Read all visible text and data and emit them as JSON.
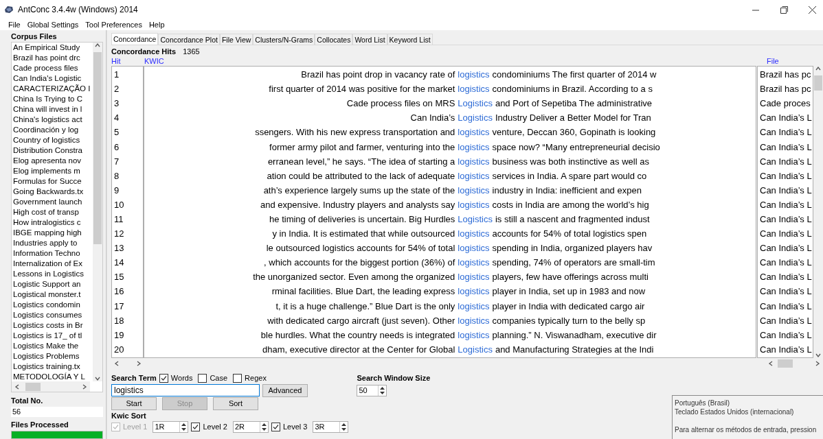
{
  "window": {
    "title": "AntConc 3.4.4w (Windows) 2014"
  },
  "menu": [
    "File",
    "Global Settings",
    "Tool Preferences",
    "Help"
  ],
  "corpus_files": {
    "label": "Corpus Files",
    "items": [
      "An Empirical Study",
      "Brazil has point drc",
      "Cade process files",
      "Can India's Logistic",
      "CARACTERIZAÇÃO I",
      "China Is Trying to C",
      "China will invest in l",
      "China's logistics act",
      "Coordinación y log",
      "Country of logistics",
      "Distribution Constra",
      "Elog apresenta nov",
      "Elog implements m",
      "Formulas for Succe",
      "Going Backwards.tx",
      "Government launch",
      "High cost of transp",
      "How intralogistics c",
      "IBGE mapping high",
      "Industries apply to",
      "Information Techno",
      "Internalization of Ex",
      "Lessons in Logistics",
      "Logistic Support an",
      "Logistical monster.t",
      "Logistics condomin",
      "Logistics consumes",
      "Logistics costs in Br",
      "Logistics is 17_ of tl",
      "Logistics Make the",
      "Logistics Problems",
      "Logistics training.tx",
      "METODOLOGÍA Y L"
    ]
  },
  "total": {
    "label": "Total No.",
    "value": "56"
  },
  "files_processed": {
    "label": "Files Processed",
    "level": 1
  },
  "tabs": [
    {
      "label": "Concordance",
      "selected": true
    },
    {
      "label": "Concordance Plot",
      "selected": false
    },
    {
      "label": "File View",
      "selected": false
    },
    {
      "label": "Clusters/N-Grams",
      "selected": false
    },
    {
      "label": "Collocates",
      "selected": false
    },
    {
      "label": "Word List",
      "selected": false
    },
    {
      "label": "Keyword List",
      "selected": false
    }
  ],
  "concordance": {
    "hits_label": "Concordance Hits",
    "hits": "1365",
    "columns": {
      "hit": "Hit",
      "kwic": "KWIC",
      "file": "File"
    },
    "rows": [
      {
        "hit": "1",
        "left": "Brazil has point drop in vacancy rate of",
        "keyword": "logistics",
        "right": "condominiums The first quarter of 2014 w",
        "file": "Brazil has pc"
      },
      {
        "hit": "2",
        "left": "first quarter of 2014 was positive for the market",
        "keyword": "logistics",
        "right": "condominiums in Brazil. According to a s",
        "file": "Brazil has pc"
      },
      {
        "hit": "3",
        "left": "Cade process files on MRS",
        "keyword": "Logistics",
        "right": "and Port of Sepetiba The administrative",
        "file": "Cade proces"
      },
      {
        "hit": "4",
        "left": "Can India’s",
        "keyword": "Logistics",
        "right": "Industry Deliver a Better Model for Tran",
        "file": "Can India’s L"
      },
      {
        "hit": "5",
        "left": "ssengers. With his new express transportation and",
        "keyword": "logistics",
        "right": "venture, Deccan 360, Gopinath is looking",
        "file": "Can India’s L"
      },
      {
        "hit": "6",
        "left": "former army pilot and farmer, venturing into the",
        "keyword": "logistics",
        "right": "space now? “Many entrepreneurial decisio",
        "file": "Can India’s L"
      },
      {
        "hit": "7",
        "left": "erranean level,” he says. “The idea of starting a",
        "keyword": "logistics",
        "right": "business was both instinctive as well as",
        "file": "Can India’s L"
      },
      {
        "hit": "8",
        "left": "ation could be attributed to the lack of adequate",
        "keyword": "logistics",
        "right": "services in India. A spare part would co",
        "file": "Can India’s L"
      },
      {
        "hit": "9",
        "left": "ath’s experience largely sums up the state of the",
        "keyword": "logistics",
        "right": "industry in India: inefficient and expen",
        "file": "Can India’s L"
      },
      {
        "hit": "10",
        "left": "and expensive. Industry players and analysts say",
        "keyword": "logistics",
        "right": "costs in India are among the world’s hig",
        "file": "Can India’s L"
      },
      {
        "hit": "11",
        "left": "he timing of deliveries is uncertain. Big Hurdles",
        "keyword": "Logistics",
        "right": "is still a nascent and fragmented indust",
        "file": "Can India’s L"
      },
      {
        "hit": "12",
        "left": "y in India. It is estimated that while outsourced",
        "keyword": "logistics",
        "right": "accounts for 54% of total logistics spen",
        "file": "Can India’s L"
      },
      {
        "hit": "13",
        "left": "le outsourced logistics accounts for 54% of total",
        "keyword": "logistics",
        "right": "spending in India, organized players hav",
        "file": "Can India’s L"
      },
      {
        "hit": "14",
        "left": ", which accounts for the biggest portion (36%) of",
        "keyword": "logistics",
        "right": "spending, 74% of operators are small-tim",
        "file": "Can India’s L"
      },
      {
        "hit": "15",
        "left": "the unorganized sector. Even among the organized",
        "keyword": "logistics",
        "right": "players, few have offerings across multi",
        "file": "Can India’s L"
      },
      {
        "hit": "16",
        "left": "rminal facilities. Blue Dart, the leading express",
        "keyword": "logistics",
        "right": "player in India, set up in 1983 and now",
        "file": "Can India’s L"
      },
      {
        "hit": "17",
        "left": "t, it is a huge challenge.” Blue Dart is the only",
        "keyword": "logistics",
        "right": "player in India with dedicated cargo air",
        "file": "Can India’s L"
      },
      {
        "hit": "18",
        "left": "with dedicated cargo aircraft (just seven). Other",
        "keyword": "logistics",
        "right": "companies typically turn to the belly sp",
        "file": "Can India’s L"
      },
      {
        "hit": "19",
        "left": "ble hurdles. What the country needs is integrated",
        "keyword": "logistics",
        "right": "planning.” N. Viswanadham, executive dir",
        "file": "Can India’s L"
      },
      {
        "hit": "20",
        "left": "dham, executive director at the Center for Global",
        "keyword": "Logistics",
        "right": "and Manufacturing Strategies at the Indi",
        "file": "Can India’s L"
      }
    ]
  },
  "search": {
    "label": "Search Term",
    "options": [
      {
        "label": "Words",
        "checked": true
      },
      {
        "label": "Case",
        "checked": false
      },
      {
        "label": "Regex",
        "checked": false
      }
    ],
    "value": "logistics",
    "advanced": "Advanced",
    "window_size_label": "Search Window Size",
    "window_size": "50"
  },
  "buttons": [
    {
      "label": "Start",
      "disabled": false
    },
    {
      "label": "Stop",
      "disabled": true
    },
    {
      "label": "Sort",
      "disabled": false
    }
  ],
  "kwic_sort": {
    "label": "Kwic Sort",
    "levels": [
      {
        "label": "Level 1",
        "checked": true,
        "disabled": true,
        "value": "1R"
      },
      {
        "label": "Level 2",
        "checked": true,
        "disabled": false,
        "value": "2R"
      },
      {
        "label": "Level 3",
        "checked": true,
        "disabled": false,
        "value": "3R"
      }
    ]
  },
  "ime_popup": {
    "lines": [
      "Português (Brasil)",
      "Teclado Estados Unidos (internacional)",
      "Para alternar os métodos de entrada, pression"
    ]
  }
}
